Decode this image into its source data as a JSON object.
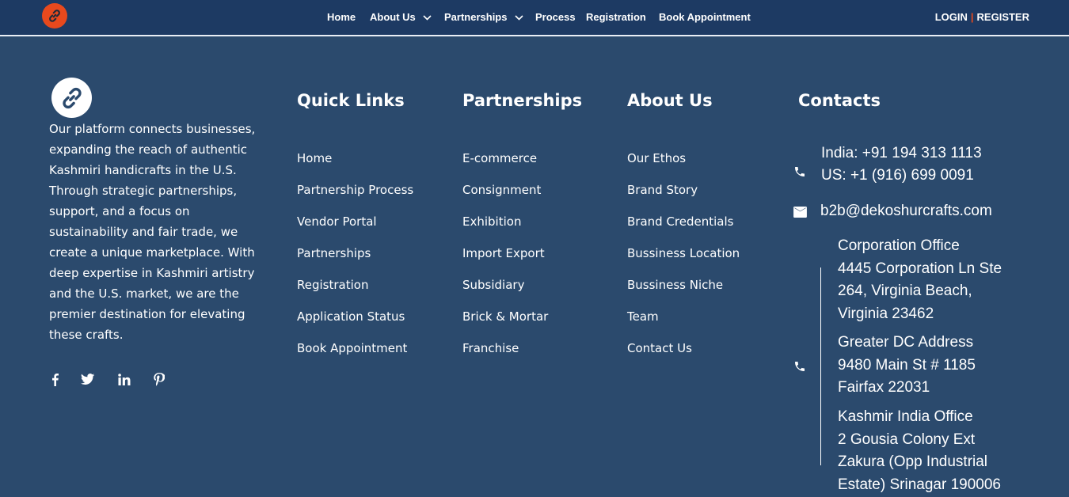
{
  "nav": {
    "items": [
      {
        "label": "Home"
      },
      {
        "label": "About Us"
      },
      {
        "label": "Partnerships"
      },
      {
        "label": "Process"
      },
      {
        "label": "Registration"
      },
      {
        "label": "Book Appointment"
      }
    ],
    "login_label": "LOGIN",
    "separator": "|",
    "register_label": "REGISTER"
  },
  "brand": {
    "accent_color": "#e8491d",
    "logo_icon": "chain-link-icon",
    "description": "Our platform connects businesses, expanding the reach of authentic Kashmiri handicrafts in the U.S. Through strategic partnerships, support, and a focus on sustainability and fair trade, we create a unique marketplace. With deep expertise in Kashmiri artistry and the U.S. market, we are the premier destination for elevating these crafts."
  },
  "socials": [
    "facebook-icon",
    "twitter-icon",
    "linkedin-icon",
    "pinterest-icon"
  ],
  "columns": {
    "quick_links": {
      "title": "Quick Links",
      "links": [
        "Home",
        "Partnership Process",
        "Vendor Portal",
        "Partnerships",
        "Registration",
        "Application Status",
        "Book Appointment"
      ]
    },
    "partnerships": {
      "title": "Partnerships",
      "links": [
        "E-commerce",
        "Consignment",
        "Exhibition",
        "Import Export",
        "Subsidiary",
        "Brick & Mortar",
        "Franchise"
      ]
    },
    "about": {
      "title": "About Us",
      "links": [
        "Our Ethos",
        "Brand Story",
        "Brand Credentials",
        "Bussiness Location",
        "Bussiness Niche",
        "Team",
        "Contact Us"
      ]
    }
  },
  "contacts": {
    "title": "Contacts",
    "phone_india": "India: +91 194 313 1113",
    "phone_us": "US: +1 (916) 699 0091",
    "email": "b2b@dekoshurcrafts.com",
    "offices": [
      {
        "name": "Corporation Office",
        "lines": [
          "4445 Corporation Ln Ste",
          "264, Virginia Beach,",
          "Virginia 23462"
        ]
      },
      {
        "name": "Greater DC Address",
        "lines": [
          "9480 Main St # 1185",
          "Fairfax 22031"
        ]
      },
      {
        "name": "Kashmir India Office",
        "lines": [
          "2 Gousia Colony Ext",
          "Zakura (Opp Industrial",
          "Estate) Srinagar 190006"
        ]
      }
    ]
  }
}
